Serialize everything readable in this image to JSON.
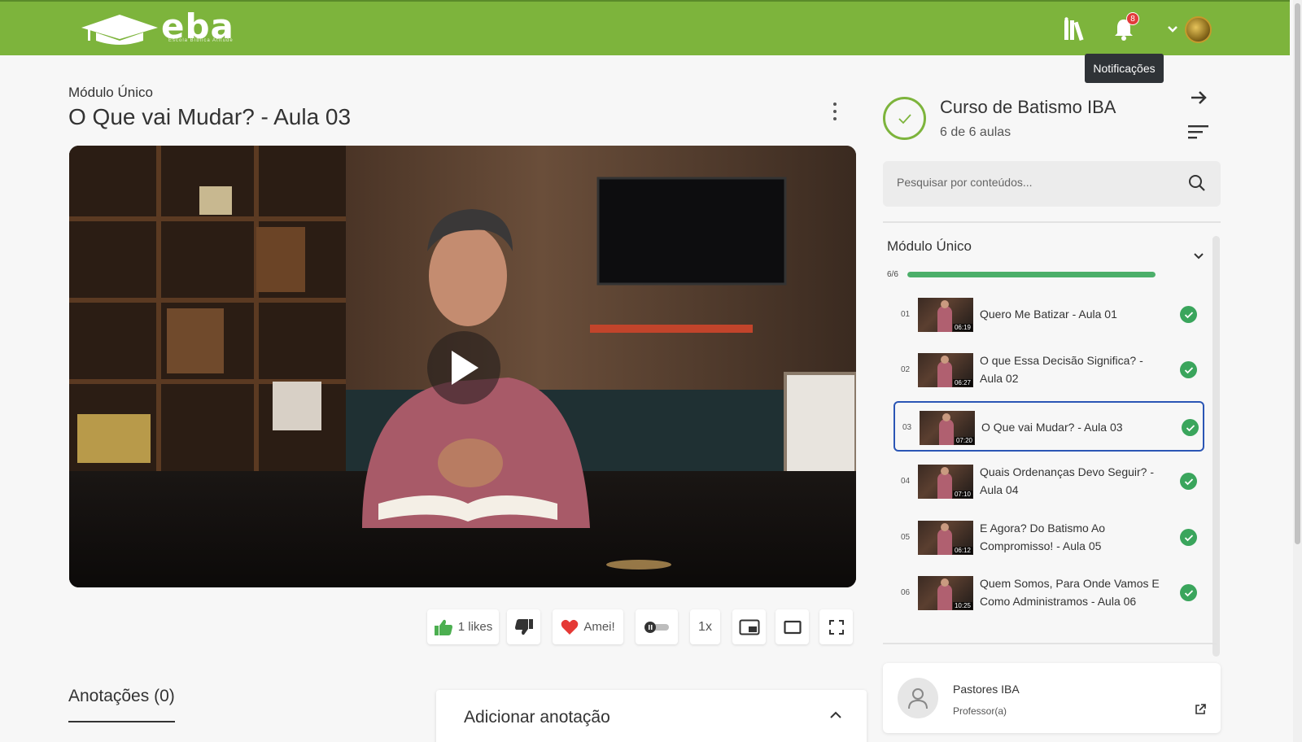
{
  "header": {
    "logo_text": "eba",
    "logo_subtitle": "Escola Bíblica Atitude",
    "notification_count": "8",
    "tooltip": "Notificações"
  },
  "lesson": {
    "module": "Módulo Único",
    "title": "O Que vai Mudar? - Aula 03"
  },
  "controls": {
    "likes_label": "1 likes",
    "love_label": "Amei!",
    "speed_label": "1x"
  },
  "notes": {
    "title": "Anotações (0)",
    "add_label": "Adicionar anotação"
  },
  "course": {
    "title": "Curso de Batismo IBA",
    "subtitle": "6 de 6 aulas",
    "search_placeholder": "Pesquisar por conteúdos...",
    "module_title": "Módulo Único",
    "progress_label": "6/6",
    "progress": 1.0,
    "lessons": [
      {
        "num": "01",
        "title": "Quero Me Batizar - Aula 01",
        "duration": "06:19",
        "active": false
      },
      {
        "num": "02",
        "title": "O que Essa Decisão Significa? - Aula 02",
        "duration": "06:27",
        "active": false
      },
      {
        "num": "03",
        "title": "O Que vai Mudar? - Aula 03",
        "duration": "07:20",
        "active": true
      },
      {
        "num": "04",
        "title": "Quais Ordenanças Devo Seguir? - Aula 04",
        "duration": "07:10",
        "active": false
      },
      {
        "num": "05",
        "title": "E Agora? Do Batismo Ao Compromisso! - Aula 05",
        "duration": "06:12",
        "active": false
      },
      {
        "num": "06",
        "title": "Quem Somos, Para Onde Vamos E Como Administramos - Aula 06",
        "duration": "10:25",
        "active": false
      }
    ]
  },
  "teacher": {
    "name": "Pastores IBA",
    "role": "Professor(a)"
  },
  "colors": {
    "brand_green": "#7db43c",
    "success_green": "#3aa55c",
    "active_border": "#2b56b5"
  }
}
